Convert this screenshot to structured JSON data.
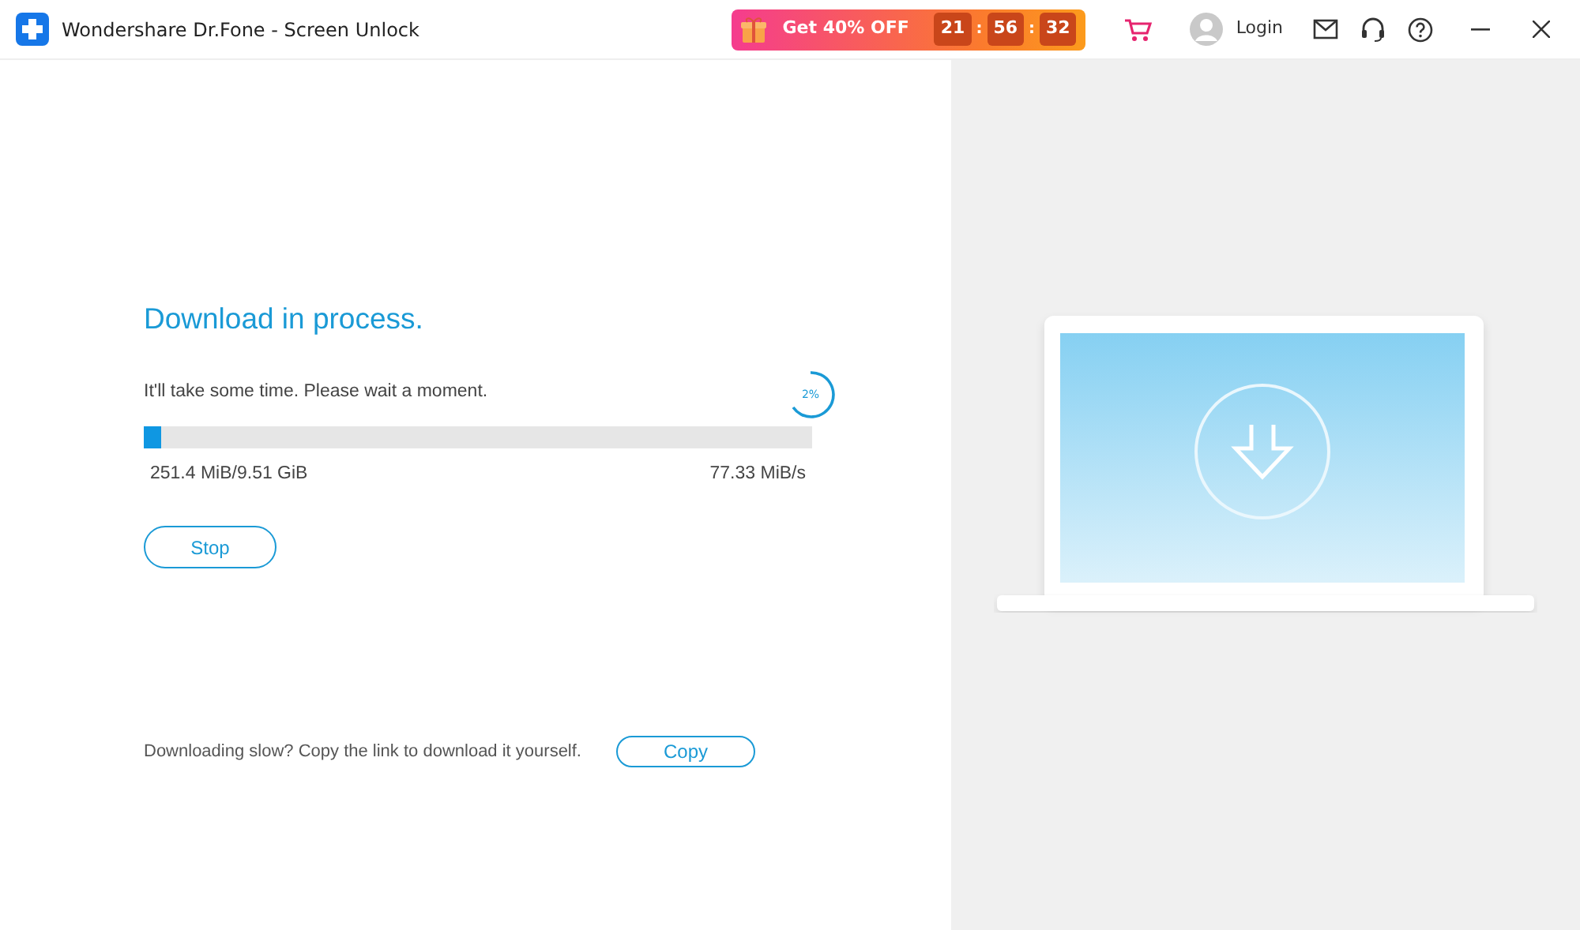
{
  "window": {
    "title": "Wondershare Dr.Fone - Screen Unlock"
  },
  "promo": {
    "label": "Get 40% OFF",
    "countdown": [
      "21",
      "56",
      "32"
    ],
    "separator": ":"
  },
  "account": {
    "label": "Login"
  },
  "download": {
    "heading": "Download in process.",
    "message": "It'll take some time. Please wait a moment.",
    "percent": "2%",
    "level": 0.026,
    "size": "251.4 MiB/9.51 GiB",
    "speed": "77.33 MiB/s",
    "stop_button": "Stop"
  },
  "footer": {
    "message": "Downloading slow? Copy the link to download it yourself.",
    "copy_button": "Copy"
  }
}
